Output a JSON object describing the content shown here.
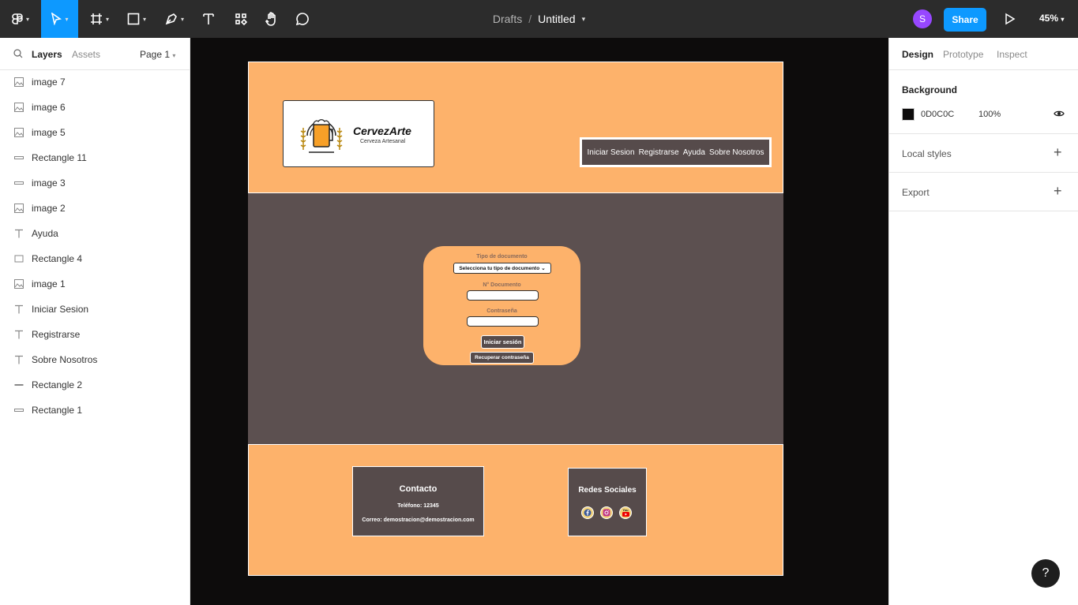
{
  "toolbar": {
    "breadcrumb": "Drafts",
    "separator": "/",
    "file_name": "Untitled",
    "avatar_initial": "S",
    "share_label": "Share",
    "zoom": "45%"
  },
  "left_panel": {
    "tab_layers": "Layers",
    "tab_assets": "Assets",
    "page_label": "Page 1",
    "layers": [
      {
        "name": "image 7",
        "kind": "image"
      },
      {
        "name": "image 6",
        "kind": "image"
      },
      {
        "name": "image 5",
        "kind": "image"
      },
      {
        "name": "Rectangle 11",
        "kind": "rect-thin"
      },
      {
        "name": "image 3",
        "kind": "rect-thin"
      },
      {
        "name": "image 2",
        "kind": "image"
      },
      {
        "name": "Ayuda",
        "kind": "text"
      },
      {
        "name": "Rectangle 4",
        "kind": "rect"
      },
      {
        "name": "image 1",
        "kind": "image"
      },
      {
        "name": "Iniciar Sesion",
        "kind": "text"
      },
      {
        "name": "Registrarse",
        "kind": "text"
      },
      {
        "name": "Sobre Nosotros",
        "kind": "text"
      },
      {
        "name": "Rectangle 2",
        "kind": "line"
      },
      {
        "name": "Rectangle 1",
        "kind": "rect-thin"
      }
    ]
  },
  "design": {
    "brand": "CervezArte",
    "tagline": "Cerveza Artesanal",
    "nav": [
      "Iniciar Sesion",
      "Registrarse",
      "Ayuda",
      "Sobre Nosotros"
    ],
    "form": {
      "doc_type_label": "Tipo de documento",
      "doc_type_select": "Selecciona tu tipo de documento",
      "doc_number_label": "N° Documento",
      "password_label": "Contraseña",
      "login_button": "Iniciar sesión",
      "recover_button": "Recuperar contraseña"
    },
    "contact": {
      "title": "Contacto",
      "phone": "Teléfono: 12345",
      "email": "Correo: demostracion@demostracion.com"
    },
    "social": {
      "title": "Redes Sociales",
      "youtube_label": "You"
    },
    "colors": {
      "orange": "#fdb26b",
      "dark": "#564b4b",
      "body": "#5c5050"
    }
  },
  "right_panel": {
    "tab_design": "Design",
    "tab_prototype": "Prototype",
    "tab_inspect": "Inspect",
    "background_title": "Background",
    "background_hex": "0D0C0C",
    "background_opacity": "100%",
    "background_color": "#0d0c0c",
    "local_styles": "Local styles",
    "export": "Export"
  },
  "help_label": "?"
}
